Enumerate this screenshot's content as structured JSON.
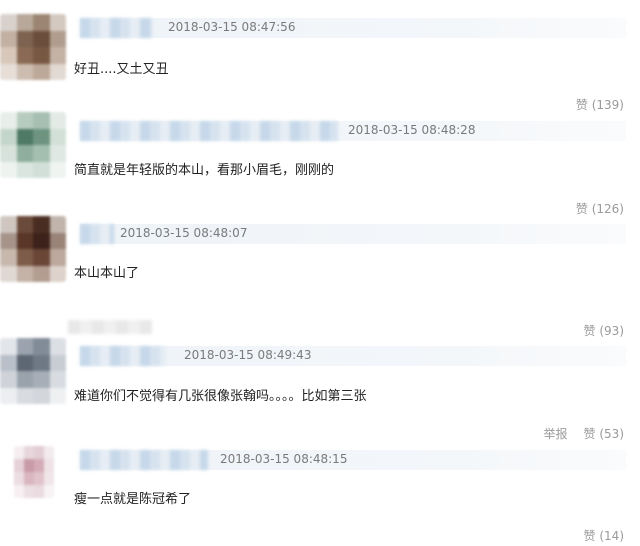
{
  "comments": [
    {
      "time": "2018-03-15 08:47:56",
      "text": "好丑....又土又丑",
      "like": "赞 (139)"
    },
    {
      "time": "2018-03-15 08:48:28",
      "text": "简直就是年轻版的本山，看那小眉毛，刚刚的",
      "like": "赞 (126)"
    },
    {
      "time": "2018-03-15 08:48:07",
      "text": "本山本山了",
      "like": "赞 (93)"
    },
    {
      "time": "2018-03-15 08:49:43",
      "text": "难道你们不觉得有几张很像张翰吗。。。。比如第三张",
      "report": "举报",
      "like": "赞 (53)"
    },
    {
      "time": "2018-03-15 08:48:15",
      "text": "瘦一点就是陈冠希了",
      "like": "赞 (14)"
    }
  ]
}
